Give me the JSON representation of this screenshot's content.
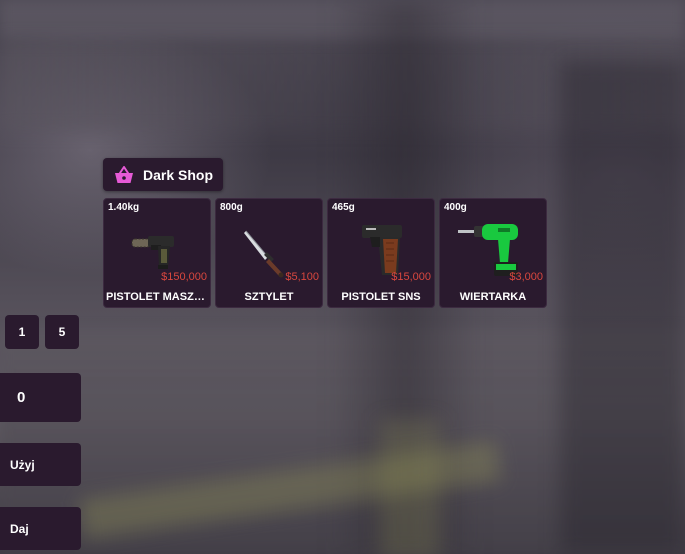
{
  "shop": {
    "title": "Dark Shop",
    "icon": "shopping-basket-icon",
    "accent_color": "#e65ad6"
  },
  "items": [
    {
      "weight": "1.40kg",
      "price": "$150,000",
      "name": "PISTOLET MASZY...",
      "icon": "machine-pistol-icon"
    },
    {
      "weight": "800g",
      "price": "$5,100",
      "name": "SZTYLET",
      "icon": "dagger-icon"
    },
    {
      "weight": "465g",
      "price": "$15,000",
      "name": "PISTOLET SNS",
      "icon": "pistol-icon"
    },
    {
      "weight": "400g",
      "price": "$3,000",
      "name": "WIERTARKA",
      "icon": "drill-icon"
    }
  ],
  "controls": {
    "qty_1": "1",
    "qty_5": "5",
    "amount": "0",
    "use_label": "Użyj",
    "give_label": "Daj"
  },
  "colors": {
    "panel": "#2a1a2e",
    "price": "#d9473e",
    "text": "#ffffff"
  }
}
